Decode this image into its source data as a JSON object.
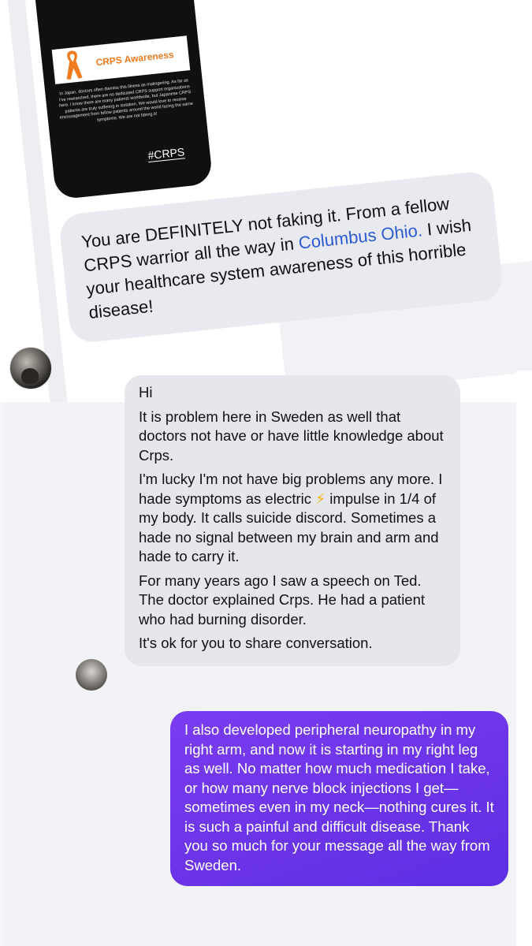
{
  "screenshot_post": {
    "awareness_title": "CRPS Awareness",
    "body_text": "In Japan, doctors often dismiss this illness as malingering. As far as I've researched, there are no dedicated CRPS support organizations here. I know there are many patients worldwide, but Japanese CRPS patients are truly suffering in isolation. We would love to receive encouragement from fellow patients around the world facing the same symptoms. We are not faking it!",
    "hashtag": "#CRPS",
    "ribbon_color": "#ef7a1f"
  },
  "reply_message": {
    "text_before": "You are DEFINITELY not faking it. From a fellow CRPS warrior all the way in ",
    "location": "Columbus Ohio.",
    "text_after": " I wish your healthcare system awareness of this horrible disease!"
  },
  "incoming_message": {
    "lines": [
      "Hi",
      "It is problem here in Sweden as well that doctors not have or have little knowledge about Crps.",
      "I'm lucky I'm not have big problems any more. I hade symptoms as electric",
      "impulse in 1/4 of my body. It calls suicide discord. Sometimes a hade no signal between my brain and arm and hade to carry it.",
      "For many years ago I saw a speech on Ted. The doctor explained Crps. He had a patient who had burning disorder.",
      "It's ok for you to share conversation."
    ],
    "bolt_emoji": "⚡"
  },
  "outgoing_message": {
    "text": "I also developed peripheral neuropathy in my right arm, and now it is starting in my right leg as well. No matter how much medication I take, or how many nerve block injections I get—sometimes even in my neck—nothing cures it. It is such a painful and difficult disease. Thank you so much for your message all the way from Sweden."
  },
  "colors": {
    "incoming_bubble": "#e6e7ec",
    "outgoing_bubble": "#6a33e8",
    "link": "#2d5bd6"
  }
}
